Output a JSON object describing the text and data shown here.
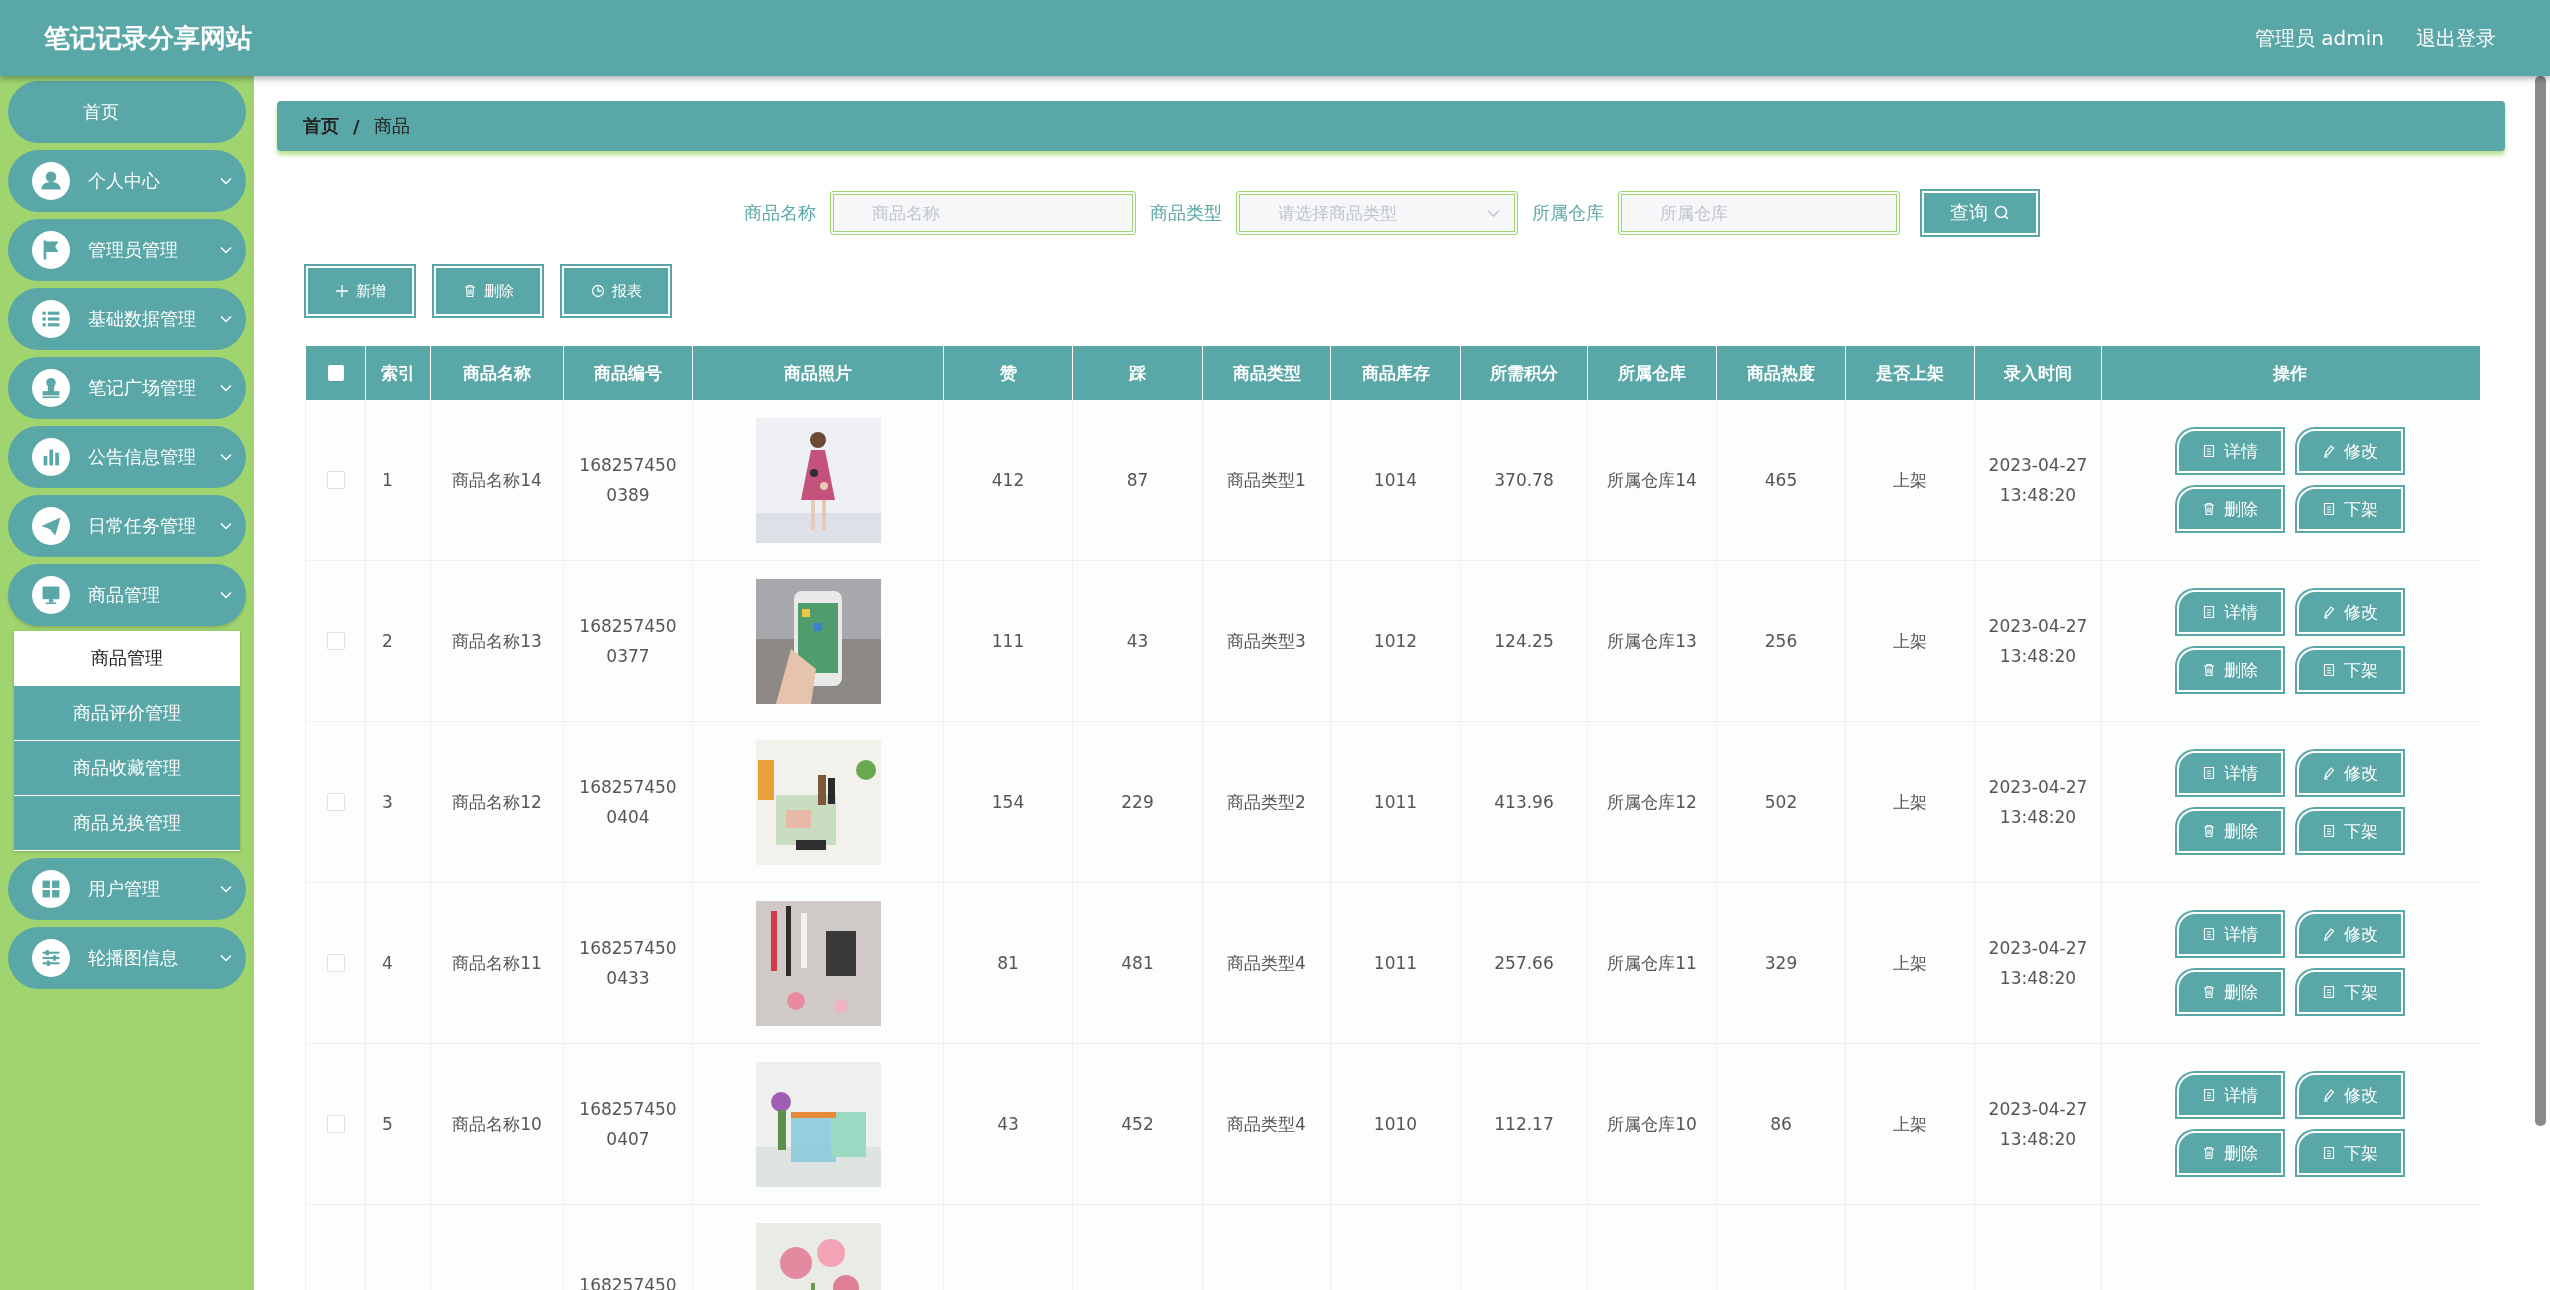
{
  "header": {
    "title": "笔记记录分享网站",
    "user": "管理员 admin",
    "logout": "退出登录"
  },
  "sidebar": {
    "items": [
      {
        "label": "首页",
        "kind": "link"
      },
      {
        "label": "个人中心",
        "kind": "menu",
        "expanded": false
      },
      {
        "label": "管理员管理",
        "kind": "menu",
        "expanded": false
      },
      {
        "label": "基础数据管理",
        "kind": "menu",
        "expanded": false
      },
      {
        "label": "笔记广场管理",
        "kind": "menu",
        "expanded": false
      },
      {
        "label": "公告信息管理",
        "kind": "menu",
        "expanded": false
      },
      {
        "label": "日常任务管理",
        "kind": "menu",
        "expanded": false
      },
      {
        "label": "商品管理",
        "kind": "menu",
        "expanded": true,
        "children": [
          {
            "label": "商品管理",
            "selected": true
          },
          {
            "label": "商品评价管理",
            "selected": false
          },
          {
            "label": "商品收藏管理",
            "selected": false
          },
          {
            "label": "商品兑换管理",
            "selected": false
          }
        ]
      },
      {
        "label": "用户管理",
        "kind": "menu",
        "expanded": false
      },
      {
        "label": "轮播图信息",
        "kind": "menu",
        "expanded": false
      }
    ]
  },
  "breadcrumb": {
    "items": [
      "首页",
      "商品"
    ],
    "separator": "/"
  },
  "search": {
    "fields": [
      {
        "label": "商品名称",
        "placeholder": "商品名称",
        "kind": "text"
      },
      {
        "label": "商品类型",
        "placeholder": "请选择商品类型",
        "kind": "select"
      },
      {
        "label": "所属仓库",
        "placeholder": "所属仓库",
        "kind": "text"
      }
    ],
    "button": "查询"
  },
  "actions": [
    "新增",
    "删除",
    "报表"
  ],
  "table": {
    "select_all": {
      "checked": false
    },
    "columns": [
      "索引",
      "商品名称",
      "商品编号",
      "商品照片",
      "赞",
      "踩",
      "商品类型",
      "商品库存",
      "所需积分",
      "所属仓库",
      "商品热度",
      "是否上架",
      "录入时间",
      "操作"
    ],
    "rows": [
      {
        "checked": false,
        "index": "1",
        "name": "商品名称14",
        "code": "1682574500389",
        "likes": "412",
        "dislikes": "87",
        "type": "商品类型1",
        "stock": "1014",
        "points": "370.78",
        "warehouse": "所属仓库14",
        "heat": "465",
        "status": "上架",
        "time": "2023-04-27 13:48:20",
        "actions": [
          "详情",
          "修改",
          "删除",
          "下架"
        ]
      },
      {
        "checked": false,
        "index": "2",
        "name": "商品名称13",
        "code": "1682574500377",
        "likes": "111",
        "dislikes": "43",
        "type": "商品类型3",
        "stock": "1012",
        "points": "124.25",
        "warehouse": "所属仓库13",
        "heat": "256",
        "status": "上架",
        "time": "2023-04-27 13:48:20",
        "actions": [
          "详情",
          "修改",
          "删除",
          "下架"
        ]
      },
      {
        "checked": false,
        "index": "3",
        "name": "商品名称12",
        "code": "1682574500404",
        "likes": "154",
        "dislikes": "229",
        "type": "商品类型2",
        "stock": "1011",
        "points": "413.96",
        "warehouse": "所属仓库12",
        "heat": "502",
        "status": "上架",
        "time": "2023-04-27 13:48:20",
        "actions": [
          "详情",
          "修改",
          "删除",
          "下架"
        ]
      },
      {
        "checked": false,
        "index": "4",
        "name": "商品名称11",
        "code": "1682574500433",
        "likes": "81",
        "dislikes": "481",
        "type": "商品类型4",
        "stock": "1011",
        "points": "257.66",
        "warehouse": "所属仓库11",
        "heat": "329",
        "status": "上架",
        "time": "2023-04-27 13:48:20",
        "actions": [
          "详情",
          "修改",
          "删除",
          "下架"
        ]
      },
      {
        "checked": false,
        "index": "5",
        "name": "商品名称10",
        "code": "1682574500407",
        "likes": "43",
        "dislikes": "452",
        "type": "商品类型4",
        "stock": "1010",
        "points": "112.17",
        "warehouse": "所属仓库10",
        "heat": "86",
        "status": "上架",
        "time": "2023-04-27 13:48:20",
        "actions": [
          "详情",
          "修改",
          "删除",
          "下架"
        ]
      },
      {
        "code": "168257450"
      }
    ]
  }
}
